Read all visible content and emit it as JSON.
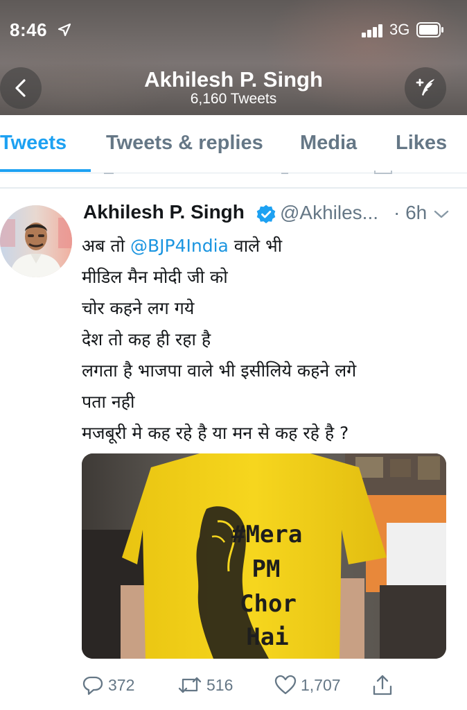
{
  "status_bar": {
    "time": "8:46",
    "network": "3G",
    "icons": [
      "location-arrow-icon",
      "signal-bars-icon",
      "battery-icon"
    ]
  },
  "header": {
    "name": "Akhilesh P. Singh",
    "tweet_count": "6,160 Tweets",
    "icons": [
      "back-chevron-icon",
      "compose-tweet-icon"
    ]
  },
  "tabs": [
    {
      "label": "Tweets",
      "active": true
    },
    {
      "label": "Tweets & replies",
      "active": false
    },
    {
      "label": "Media",
      "active": false
    },
    {
      "label": "Likes",
      "active": false
    }
  ],
  "tweet": {
    "author_name": "Akhilesh P. Singh",
    "handle": "@Akhiles...",
    "time": "· 6h",
    "verified": true,
    "text_prefix": "अब तो ",
    "mention": "@BJP4India",
    "text_suffix": " वाले भी",
    "lines": [
      "मीडिल मैन मोदी जी को",
      "चोर कहने लग गये",
      "देश तो कह ही रहा है",
      "लगता है भाजपा वाले भी इसीलिये कहने लगे",
      "पता नही",
      "मजबूरी मे कह रहे है या मन से कह रहे है ?"
    ],
    "image_shirt_text": [
      "#Mera",
      "PM",
      "Chor",
      "Hai"
    ],
    "actions": {
      "replies": "372",
      "retweets": "516",
      "likes": "1,707"
    }
  },
  "colors": {
    "accent": "#1da1f2",
    "mention": "#1b95e0",
    "secondary_text": "#657786",
    "verified": "#1da1f2",
    "shirt": "#f2d31c"
  }
}
